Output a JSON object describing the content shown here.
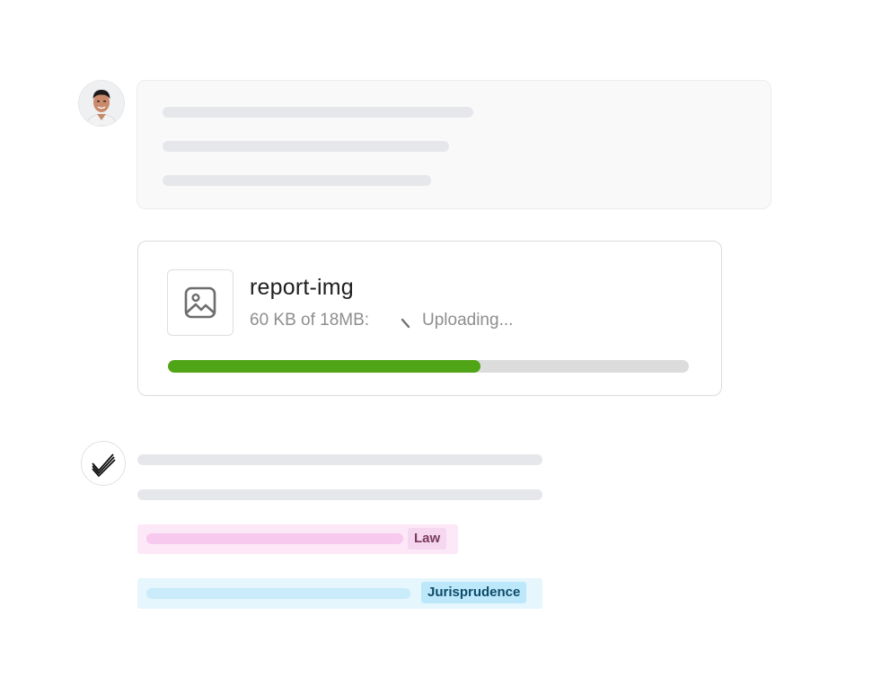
{
  "upload": {
    "file_name": "report-img",
    "size_text": "60 KB of 18MB:",
    "status_text": "Uploading...",
    "progress_fraction": 0.6,
    "progress_color": "#4fa515",
    "thumbnail_icon": "image-icon",
    "status_icon": "spinner-icon"
  },
  "assistant": {
    "avatar_icon": "double-check-icon"
  },
  "tags": {
    "law": {
      "label": "Law",
      "color": "#f5d7ef",
      "text_color": "#7a3a5e"
    },
    "jurisprudence": {
      "label": "Jurisprudence",
      "color": "#bde8fb",
      "text_color": "#0e4c69"
    }
  }
}
